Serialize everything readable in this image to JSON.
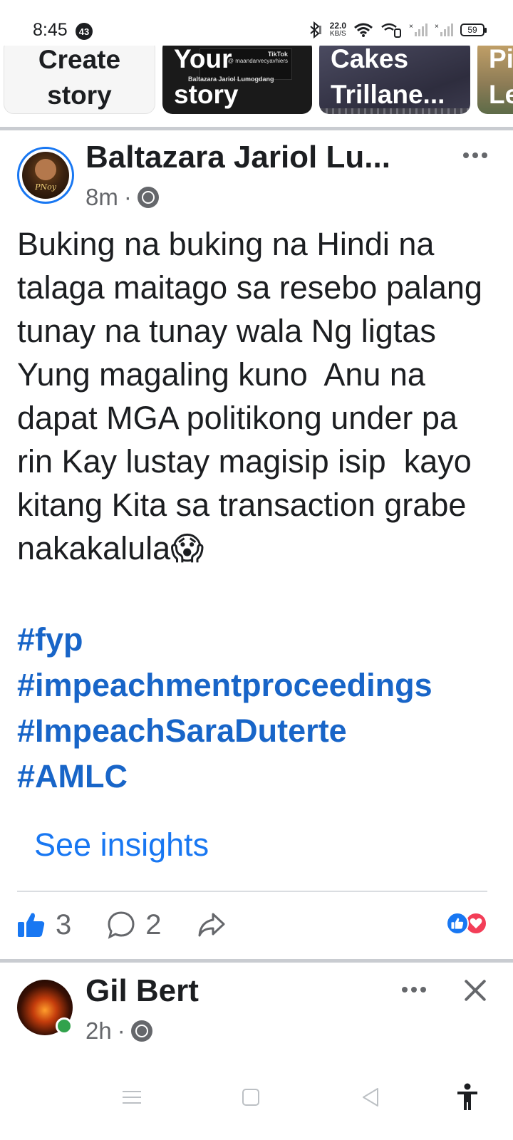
{
  "status_bar": {
    "time": "8:45",
    "notification_count": "43",
    "net_speed": "22.0",
    "net_unit": "KB/S",
    "battery": "59"
  },
  "stories": [
    {
      "line1": "Create",
      "line2": "story"
    },
    {
      "line1": "Your",
      "line2": "story",
      "thumb_brand": "TikTok",
      "thumb_handle": "@ maandarvecyavhiers",
      "thumb_name": "Baltazara Jariol Lumogdang"
    },
    {
      "line1": "Cakes",
      "line2": "Trillane..."
    },
    {
      "line1": "Pi",
      "line2": "Le"
    }
  ],
  "post1": {
    "author": "Baltazara Jariol Lu...",
    "avatar_text": "PNoy",
    "time": "8m",
    "separator": "·",
    "text": "Buking na buking na Hindi na talaga maitago sa resebo palang tunay na tunay wala Ng ligtas Yung magaling kuno  Anu na dapat MGA politikong under pa rin Kay lustay magisip isip  kayo kitang Kita sa transaction grabe nakakalula😱",
    "hashtags": [
      "#fyp",
      "#impeachmentproceedings",
      "#ImpeachSaraDuterte",
      "#AMLC"
    ],
    "insights_label": "See insights",
    "like_count": "3",
    "comment_count": "2"
  },
  "post2": {
    "author": "Gil Bert",
    "time": "2h",
    "separator": "·"
  },
  "colors": {
    "brand_blue": "#1877f2",
    "hashtag_blue": "#1865c8",
    "love_red": "#f33e58",
    "online_green": "#31a24c",
    "muted": "#65676b"
  },
  "icons": [
    "bluetooth-icon",
    "wifi-icon",
    "wifi-calling-icon",
    "signal-icon",
    "battery-icon",
    "globe-icon",
    "more-icon",
    "like-icon",
    "comment-icon",
    "share-icon",
    "close-icon",
    "menu-icon",
    "home-icon",
    "back-icon",
    "accessibility-icon"
  ]
}
